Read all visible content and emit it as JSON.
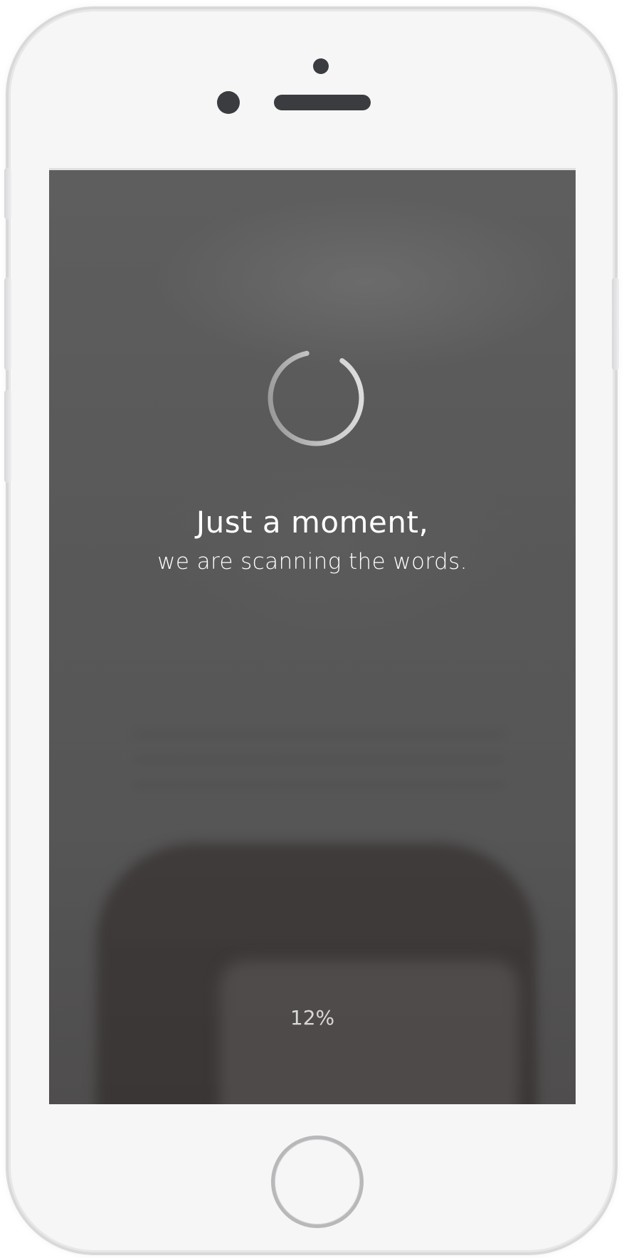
{
  "loading": {
    "title": "Just a moment,",
    "subtitle": "we are scanning the words.",
    "progress_percent_text": "12%",
    "progress_percent_value": 12
  },
  "icons": {
    "spinner": "loading-spinner-icon",
    "home": "home-button-icon"
  },
  "colors": {
    "screen_overlay": "#585858",
    "text": "#ffffff",
    "percent_text": "#d8d8d8",
    "phone_body": "#f6f6f6"
  }
}
